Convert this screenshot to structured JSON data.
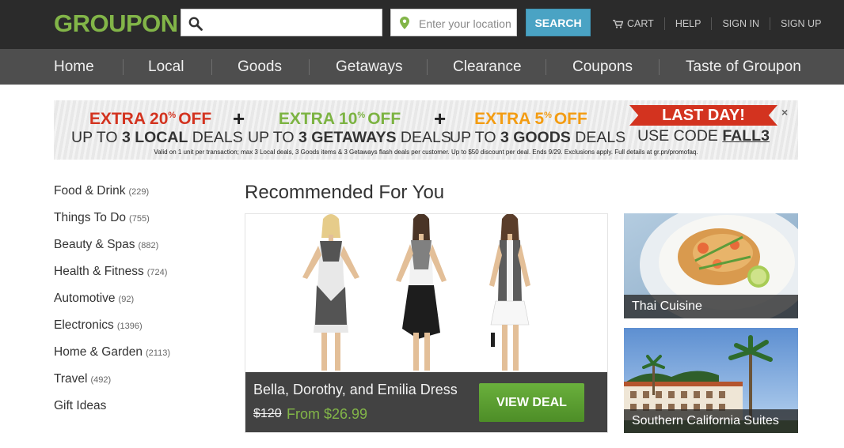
{
  "header": {
    "logo": "GROUPON",
    "search": {
      "placeholder": ""
    },
    "location": {
      "placeholder": "Enter your location"
    },
    "search_button": "SEARCH",
    "links": {
      "cart": "CART",
      "help": "HELP",
      "sign_in": "SIGN IN",
      "sign_up": "SIGN UP"
    }
  },
  "nav": {
    "items": [
      "Home",
      "Local",
      "Goods",
      "Getaways",
      "Clearance",
      "Coupons",
      "Taste of Groupon"
    ]
  },
  "banner": {
    "offers": [
      {
        "pct": "20",
        "sup": "%",
        "word": "OFF",
        "prefix": "EXTRA ",
        "line2_a": "UP TO ",
        "line2_b": "3 LOCAL",
        "line2_c": " DEALS",
        "color": "#d3331f"
      },
      {
        "pct": "10",
        "sup": "%",
        "word": "OFF",
        "prefix": "EXTRA ",
        "line2_a": "UP TO ",
        "line2_b": "3 GETAWAYS",
        "line2_c": " DEALS",
        "color": "#7cb342"
      },
      {
        "pct": "5",
        "sup": "%",
        "word": "OFF",
        "prefix": "EXTRA ",
        "line2_a": "UP TO ",
        "line2_b": "3 GOODS",
        "line2_c": " DEALS",
        "color": "#f39c12"
      }
    ],
    "plus": "+",
    "last_day": "LAST DAY!",
    "use_code_prefix": "USE CODE ",
    "code": "FALL3",
    "fine_print": "Valid on 1 unit per transaction; max 3 Local deals, 3 Goods items & 3 Getaways flash deals per customer. Up to $50 discount per deal. Ends 9/29. Exclusions apply. Full details at gr.pn/promofaq.",
    "close": "×"
  },
  "sidebar": {
    "categories": [
      {
        "name": "Food & Drink",
        "count": "(229)"
      },
      {
        "name": "Things To Do",
        "count": "(755)"
      },
      {
        "name": "Beauty & Spas",
        "count": "(882)"
      },
      {
        "name": "Health & Fitness",
        "count": "(724)"
      },
      {
        "name": "Automotive",
        "count": "(92)"
      },
      {
        "name": "Electronics",
        "count": "(1396)"
      },
      {
        "name": "Home & Garden",
        "count": "(2113)"
      },
      {
        "name": "Travel",
        "count": "(492)"
      },
      {
        "name": "Gift Ideas",
        "count": ""
      }
    ]
  },
  "main": {
    "title": "Recommended For You",
    "featured": {
      "title": "Bella, Dorothy, and Emilia Dress",
      "old_price": "$120",
      "new_price": "From $26.99",
      "button": "VIEW DEAL"
    },
    "side_deals": [
      {
        "label": "Thai Cuisine"
      },
      {
        "label": "Southern California Suites"
      }
    ]
  },
  "colors": {
    "brand_green": "#82b548",
    "search_blue": "#4aa3c4",
    "topbar": "#2b2b2b",
    "nav": "#4e4e4e"
  },
  "icons": {
    "search": "search-icon",
    "location": "location-pin-icon",
    "cart": "cart-icon",
    "close": "close-icon"
  }
}
